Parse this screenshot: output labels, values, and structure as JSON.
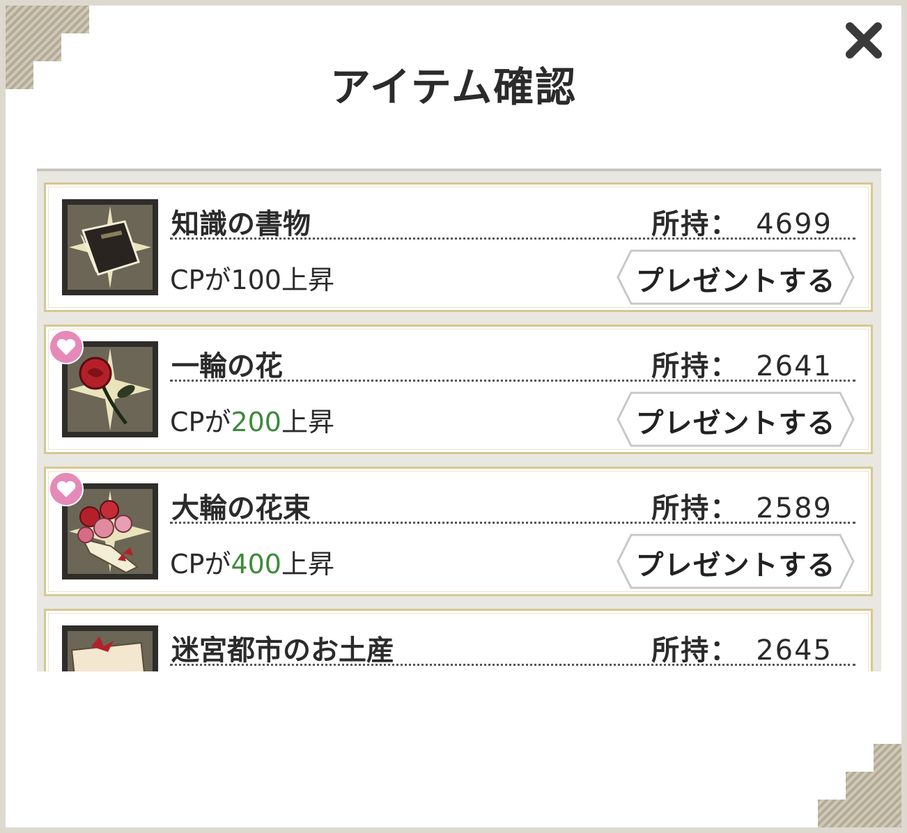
{
  "dialog": {
    "title": "アイテム確認",
    "close_icon": "close-x-icon"
  },
  "items": [
    {
      "name": "知識の書物",
      "owned_label": "所持：",
      "owned_count": "4699",
      "effect_prefix": "CPが",
      "effect_value": "100",
      "effect_suffix": "上昇",
      "effect_highlight": false,
      "favorite": false,
      "icon": "book-icon",
      "button_label": "プレゼントする"
    },
    {
      "name": "一輪の花",
      "owned_label": "所持：",
      "owned_count": "2641",
      "effect_prefix": "CPが",
      "effect_value": "200",
      "effect_suffix": "上昇",
      "effect_highlight": true,
      "favorite": true,
      "icon": "rose-icon",
      "button_label": "プレゼントする"
    },
    {
      "name": "大輪の花束",
      "owned_label": "所持：",
      "owned_count": "2589",
      "effect_prefix": "CPが",
      "effect_value": "400",
      "effect_suffix": "上昇",
      "effect_highlight": true,
      "favorite": true,
      "icon": "bouquet-icon",
      "button_label": "プレゼントする"
    },
    {
      "name": "迷宮都市のお土産",
      "owned_label": "所持：",
      "owned_count": "2645",
      "icon": "gift-icon"
    }
  ],
  "colors": {
    "highlight_value": "#3d8a3a",
    "item_border": "#d6c792",
    "heart": "#e58ab8"
  }
}
